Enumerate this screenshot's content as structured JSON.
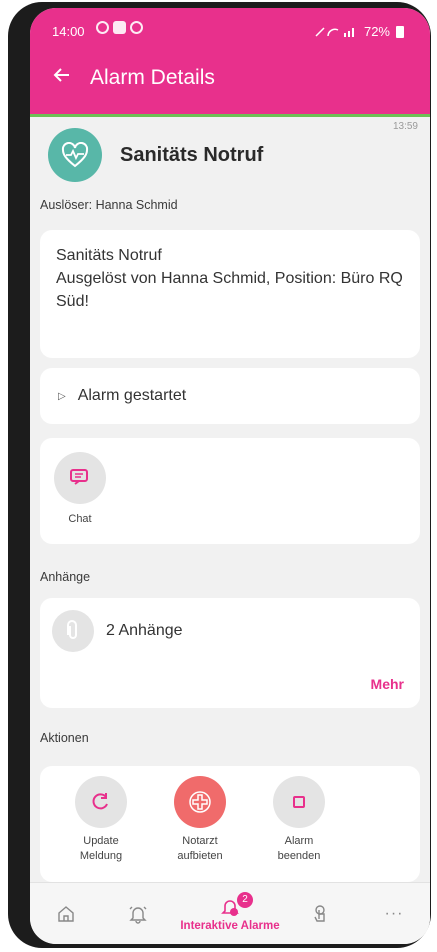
{
  "status_bar": {
    "time": "14:00",
    "battery": "72%"
  },
  "app_bar": {
    "title": "Alarm Details"
  },
  "alarm": {
    "timestamp": "13:59",
    "title": "Sanitäts Notruf",
    "trigger_label": "Auslöser: Hanna Schmid",
    "message_line1": "Sanitäts Notruf",
    "message_line2": "Ausgelöst von Hanna Schmid, Position: Büro RQ Süd!",
    "event": "Alarm gestartet"
  },
  "chat": {
    "label": "Chat"
  },
  "attachments": {
    "section_label": "Anhänge",
    "count_text": "2 Anhänge",
    "more_label": "Mehr"
  },
  "actions": {
    "section_label": "Aktionen",
    "items": [
      {
        "line1": "Update",
        "line2": "Meldung"
      },
      {
        "line1": "Notarzt",
        "line2": "aufbieten"
      },
      {
        "line1": "Alarm",
        "line2": "beenden"
      }
    ]
  },
  "bottom_nav": {
    "active_label": "Interaktive Alarme",
    "badge": "2"
  },
  "colors": {
    "brand": "#e8308c",
    "accent_green": "#6dbf55",
    "alarm_icon_bg": "#58b7a8",
    "notarzt_bg": "#f06b6b"
  },
  "icons": [
    "back-arrow-icon",
    "heart-pulse-icon",
    "chat-icon",
    "paperclip-icon",
    "refresh-icon",
    "medical-cross-icon",
    "stop-square-icon",
    "home-icon",
    "bell-icon",
    "alarm-bell-icon",
    "touch-icon",
    "more-icon"
  ]
}
